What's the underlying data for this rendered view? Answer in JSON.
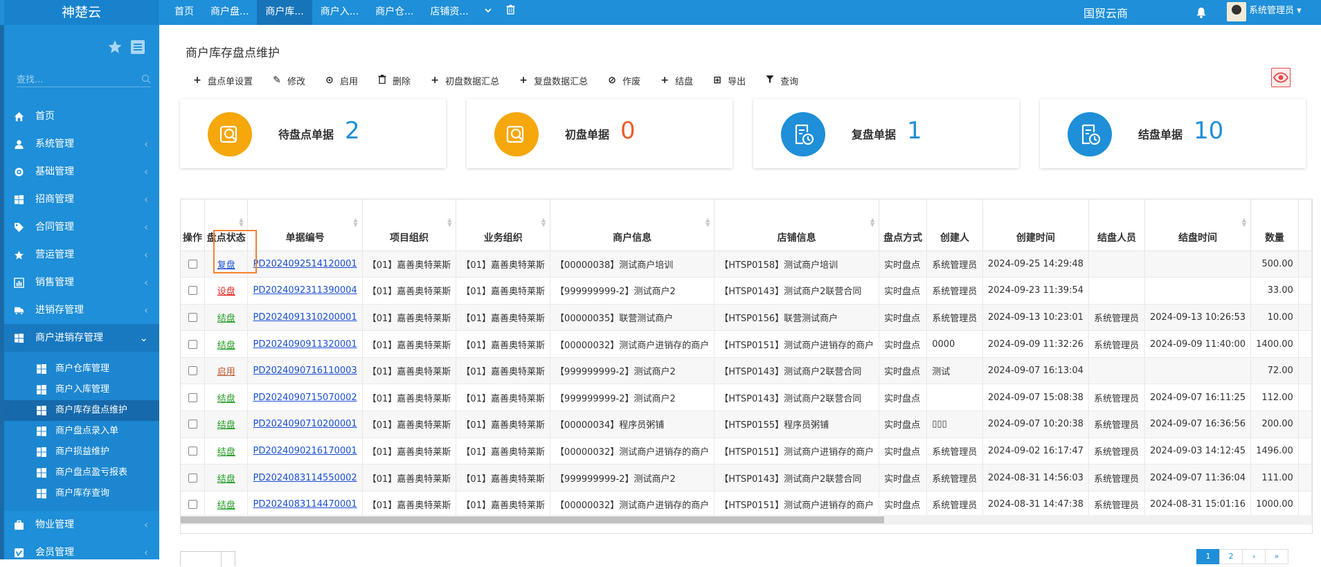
{
  "app": {
    "logo": "神楚云",
    "company": "国贸云商",
    "user": "系统管理员"
  },
  "topnav": [
    {
      "label": "首页",
      "active": false
    },
    {
      "label": "商户盘...",
      "active": false
    },
    {
      "label": "商户库...",
      "active": true
    },
    {
      "label": "商户入...",
      "active": false
    },
    {
      "label": "商户仓...",
      "active": false
    },
    {
      "label": "店铺资...",
      "active": false
    }
  ],
  "sidebar": {
    "search_placeholder": "查找...",
    "menu": [
      {
        "label": "首页",
        "icon": "home-icon"
      },
      {
        "label": "系统管理",
        "icon": "user-icon"
      },
      {
        "label": "基础管理",
        "icon": "gear-icon"
      },
      {
        "label": "招商管理",
        "icon": "windows-icon"
      },
      {
        "label": "合同管理",
        "icon": "tag-icon"
      },
      {
        "label": "营运管理",
        "icon": "star-icon"
      },
      {
        "label": "销售管理",
        "icon": "bar-chart-icon"
      },
      {
        "label": "进销存管理",
        "icon": "truck-icon"
      },
      {
        "label": "商户进销存管理",
        "icon": "windows-icon"
      }
    ],
    "submenu": [
      {
        "label": "商户仓库管理",
        "active": false
      },
      {
        "label": "商户入库管理",
        "active": false
      },
      {
        "label": "商户库存盘点维护",
        "active": true
      },
      {
        "label": "商户盘点录入单",
        "active": false
      },
      {
        "label": "商户损益维护",
        "active": false
      },
      {
        "label": "商户盘点盈亏报表",
        "active": false
      },
      {
        "label": "商户库存查询",
        "active": false
      }
    ],
    "menu_after": [
      {
        "label": "物业管理",
        "icon": "briefcase-icon"
      },
      {
        "label": "会员管理",
        "icon": "vimeo-icon"
      }
    ]
  },
  "page": {
    "title": "商户库存盘点维护"
  },
  "toolbar": [
    {
      "label": "盘点单设置",
      "icon": "plus-icon",
      "glyph": "+"
    },
    {
      "label": "修改",
      "icon": "edit-icon",
      "glyph": "✎"
    },
    {
      "label": "启用",
      "icon": "check-circle-icon",
      "glyph": "⊙"
    },
    {
      "label": "删除",
      "icon": "trash-icon",
      "glyph": "🗑"
    },
    {
      "label": "初盘数据汇总",
      "icon": "plus-icon",
      "glyph": "+"
    },
    {
      "label": "复盘数据汇总",
      "icon": "plus-icon",
      "glyph": "+"
    },
    {
      "label": "作废",
      "icon": "ban-icon",
      "glyph": "⊘"
    },
    {
      "label": "结盘",
      "icon": "plus-icon",
      "glyph": "+"
    },
    {
      "label": "导出",
      "icon": "table-icon",
      "glyph": "⊞"
    },
    {
      "label": "查询",
      "icon": "filter-icon",
      "glyph": "▼"
    }
  ],
  "cards": [
    {
      "label": "待盘点单据",
      "value": "2",
      "color": "#f5a70b",
      "value_color": "#1e8fd8",
      "icon": "inspect-icon"
    },
    {
      "label": "初盘单据",
      "value": "0",
      "color": "#f5a70b",
      "value_color": "#f05a28",
      "icon": "inspect-icon"
    },
    {
      "label": "复盘单据",
      "value": "1",
      "color": "#1e8fd8",
      "value_color": "#1e8fd8",
      "icon": "clock-doc-icon"
    },
    {
      "label": "结盘单据",
      "value": "10",
      "color": "#1e8fd8",
      "value_color": "#1e8fd8",
      "icon": "clock-doc-icon"
    }
  ],
  "table": {
    "columns": [
      "操作",
      "盘点状态",
      "单据编号",
      "项目组织",
      "业务组织",
      "商户信息",
      "店铺信息",
      "盘点方式",
      "创建人",
      "创建时间",
      "结盘人员",
      "结盘时间",
      "数量"
    ],
    "rows": [
      {
        "status": "复盘",
        "status_color": "#1a4fd6",
        "doc": "PD2024092514120001",
        "project": "【01】嘉善奥特莱斯",
        "business": "【01】嘉善奥特莱斯",
        "merchant": "【00000038】测试商户培训",
        "shop": "【HTSP0158】测试商户培训",
        "method": "实时盘点",
        "creator": "系统管理员",
        "created": "2024-09-25 14:29:48",
        "closer": "",
        "closed": "",
        "qty": "500.00"
      },
      {
        "status": "设盘",
        "status_color": "#e02020",
        "doc": "PD2024092311390004",
        "project": "【01】嘉善奥特莱斯",
        "business": "【01】嘉善奥特莱斯",
        "merchant": "【999999999-2】测试商户2",
        "shop": "【HTSP0143】测试商户2联营合同",
        "method": "实时盘点",
        "creator": "系统管理员",
        "created": "2024-09-23 11:39:54",
        "closer": "",
        "closed": "",
        "qty": "33.00"
      },
      {
        "status": "结盘",
        "status_color": "#1e9b1e",
        "doc": "PD2024091310200001",
        "project": "【01】嘉善奥特莱斯",
        "business": "【01】嘉善奥特莱斯",
        "merchant": "【00000035】联营测试商户",
        "shop": "【HTSP0156】联营测试商户",
        "method": "实时盘点",
        "creator": "系统管理员",
        "created": "2024-09-13 10:23:01",
        "closer": "系统管理员",
        "closed": "2024-09-13 10:26:53",
        "qty": "10.00"
      },
      {
        "status": "结盘",
        "status_color": "#1e9b1e",
        "doc": "PD2024090911320001",
        "project": "【01】嘉善奥特莱斯",
        "business": "【01】嘉善奥特莱斯",
        "merchant": "【00000032】测试商户进销存的商户",
        "shop": "【HTSP0151】测试商户进销存的商户",
        "method": "实时盘点",
        "creator": "0000",
        "created": "2024-09-09 11:32:26",
        "closer": "系统管理员",
        "closed": "2024-09-09 11:40:00",
        "qty": "1400.00"
      },
      {
        "status": "启用",
        "status_color": "#c0552a",
        "doc": "PD2024090716110003",
        "project": "【01】嘉善奥特莱斯",
        "business": "【01】嘉善奥特莱斯",
        "merchant": "【999999999-2】测试商户2",
        "shop": "【HTSP0143】测试商户2联营合同",
        "method": "实时盘点",
        "creator": "测试",
        "created": "2024-09-07 16:13:04",
        "closer": "",
        "closed": "",
        "qty": "72.00"
      },
      {
        "status": "结盘",
        "status_color": "#1e9b1e",
        "doc": "PD2024090715070002",
        "project": "【01】嘉善奥特莱斯",
        "business": "【01】嘉善奥特莱斯",
        "merchant": "【999999999-2】测试商户2",
        "shop": "【HTSP0143】测试商户2联营合同",
        "method": "实时盘点",
        "creator": "",
        "created": "2024-09-07 15:08:38",
        "closer": "系统管理员",
        "closed": "2024-09-07 16:11:25",
        "qty": "112.00"
      },
      {
        "status": "结盘",
        "status_color": "#1e9b1e",
        "doc": "PD2024090710200001",
        "project": "【01】嘉善奥特莱斯",
        "business": "【01】嘉善奥特莱斯",
        "merchant": "【00000034】程序员粥铺",
        "shop": "【HTSP0155】程序员粥铺",
        "method": "实时盘点",
        "creator": "▯▯▯",
        "created": "2024-09-07 10:20:38",
        "closer": "系统管理员",
        "closed": "2024-09-07 16:36:56",
        "qty": "200.00"
      },
      {
        "status": "结盘",
        "status_color": "#1e9b1e",
        "doc": "PD2024090216170001",
        "project": "【01】嘉善奥特莱斯",
        "business": "【01】嘉善奥特莱斯",
        "merchant": "【00000032】测试商户进销存的商户",
        "shop": "【HTSP0151】测试商户进销存的商户",
        "method": "实时盘点",
        "creator": "系统管理员",
        "created": "2024-09-02 16:17:47",
        "closer": "系统管理员",
        "closed": "2024-09-03 14:12:45",
        "qty": "1496.00"
      },
      {
        "status": "结盘",
        "status_color": "#1e9b1e",
        "doc": "PD2024083114550002",
        "project": "【01】嘉善奥特莱斯",
        "business": "【01】嘉善奥特莱斯",
        "merchant": "【999999999-2】测试商户2",
        "shop": "【HTSP0143】测试商户2联营合同",
        "method": "实时盘点",
        "creator": "系统管理员",
        "created": "2024-08-31 14:56:03",
        "closer": "系统管理员",
        "closed": "2024-09-07 11:36:04",
        "qty": "111.00"
      },
      {
        "status": "结盘",
        "status_color": "#1e9b1e",
        "doc": "PD2024083114470001",
        "project": "【01】嘉善奥特莱斯",
        "business": "【01】嘉善奥特莱斯",
        "merchant": "【00000032】测试商户进销存的商户",
        "shop": "【HTSP0151】测试商户进销存的商户",
        "method": "实时盘点",
        "creator": "系统管理员",
        "created": "2024-08-31 14:47:38",
        "closer": "系统管理员",
        "closed": "2024-08-31 15:01:16",
        "qty": "1000.00"
      }
    ]
  },
  "pager": [
    "1",
    "2",
    "›",
    "»"
  ]
}
